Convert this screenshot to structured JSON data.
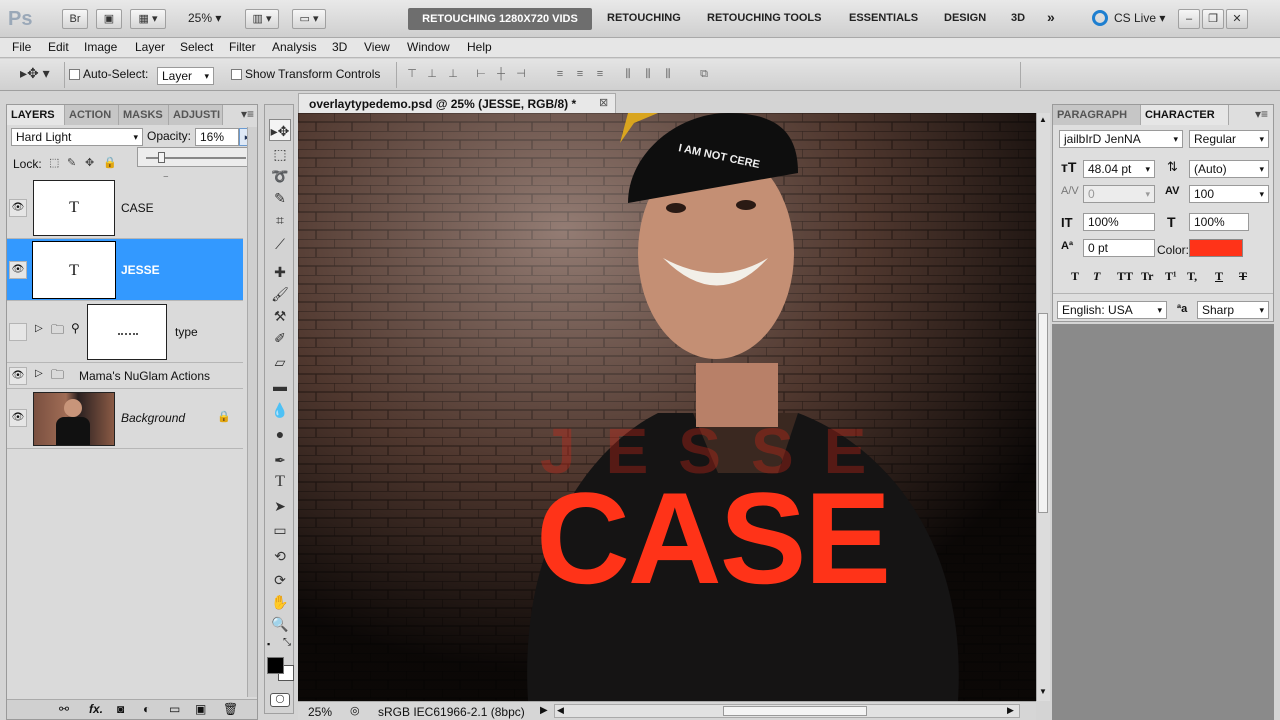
{
  "appbar": {
    "logo": "Ps",
    "br": "Br",
    "zoom": "25%",
    "workspace_active": "RETOUCHING 1280X720 VIDS",
    "workspaces": [
      "RETOUCHING",
      "RETOUCHING TOOLS",
      "ESSENTIALS",
      "DESIGN",
      "3D"
    ],
    "more": "»",
    "cs_live": "CS Live"
  },
  "menu": [
    "File",
    "Edit",
    "Image",
    "Layer",
    "Select",
    "Filter",
    "Analysis",
    "3D",
    "View",
    "Window",
    "Help"
  ],
  "options": {
    "auto_select_label": "Auto-Select:",
    "auto_select_value": "Layer",
    "show_transform_label": "Show Transform Controls"
  },
  "layers_panel": {
    "tabs": [
      "LAYERS",
      "ACTION",
      "MASKS",
      "ADJUSTI"
    ],
    "blend_mode": "Hard Light",
    "opacity_label": "Opacity:",
    "opacity_value": "16%",
    "lock_label": "Lock:",
    "layers": [
      {
        "name": "CASE",
        "thumb": "T"
      },
      {
        "name": "JESSE",
        "thumb": "T"
      },
      {
        "name": "type"
      },
      {
        "name": "Mama's NuGlam Actions"
      },
      {
        "name": "Background"
      }
    ]
  },
  "document": {
    "tab_title": "overlaytypedemo.psd @ 25% (JESSE, RGB/8) *",
    "text_case": "CASE",
    "text_jesse": "JESSE",
    "cap_text": "I AM NOT CERE",
    "status_zoom": "25%",
    "status_profile": "sRGB IEC61966-2.1 (8bpc)"
  },
  "character_panel": {
    "tabs": [
      "PARAGRAPH",
      "CHARACTER"
    ],
    "font_family": "jailbIrD JenNA",
    "font_style": "Regular",
    "font_size": "48.04 pt",
    "leading": "(Auto)",
    "kerning": "0",
    "tracking": "100",
    "vscale": "100%",
    "hscale": "100%",
    "baseline": "0 pt",
    "color_label": "Color:",
    "color_value": "#ff3318",
    "style_buttons": [
      "T",
      "T",
      "TT",
      "Tr",
      "T¹",
      "T,",
      "T",
      "T"
    ],
    "language": "English: USA",
    "aa_label": "ªa",
    "antialias": "Sharp"
  }
}
